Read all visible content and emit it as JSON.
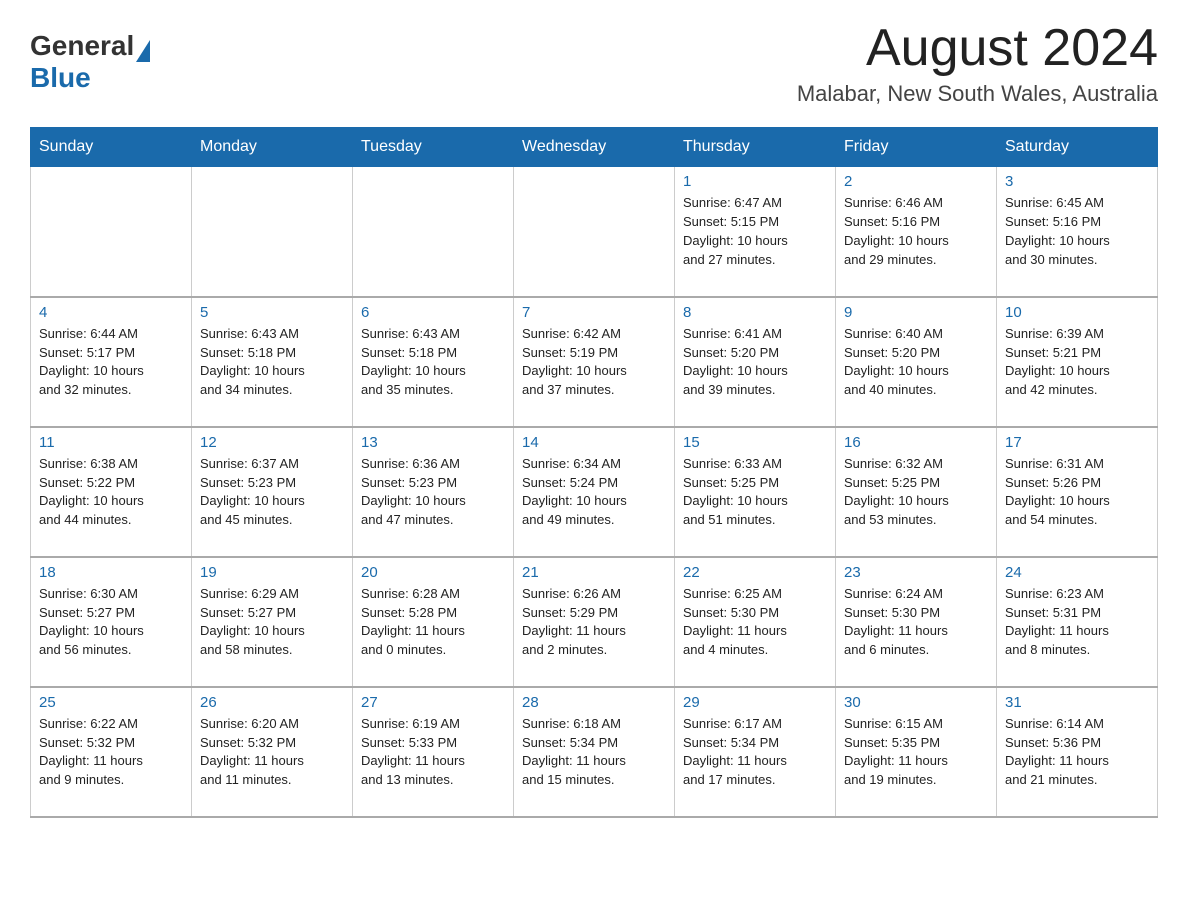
{
  "header": {
    "logo": {
      "general": "General",
      "blue": "Blue"
    },
    "title": "August 2024",
    "location": "Malabar, New South Wales, Australia"
  },
  "days_of_week": [
    "Sunday",
    "Monday",
    "Tuesday",
    "Wednesday",
    "Thursday",
    "Friday",
    "Saturday"
  ],
  "weeks": [
    [
      {
        "day": "",
        "info": ""
      },
      {
        "day": "",
        "info": ""
      },
      {
        "day": "",
        "info": ""
      },
      {
        "day": "",
        "info": ""
      },
      {
        "day": "1",
        "info": "Sunrise: 6:47 AM\nSunset: 5:15 PM\nDaylight: 10 hours\nand 27 minutes."
      },
      {
        "day": "2",
        "info": "Sunrise: 6:46 AM\nSunset: 5:16 PM\nDaylight: 10 hours\nand 29 minutes."
      },
      {
        "day": "3",
        "info": "Sunrise: 6:45 AM\nSunset: 5:16 PM\nDaylight: 10 hours\nand 30 minutes."
      }
    ],
    [
      {
        "day": "4",
        "info": "Sunrise: 6:44 AM\nSunset: 5:17 PM\nDaylight: 10 hours\nand 32 minutes."
      },
      {
        "day": "5",
        "info": "Sunrise: 6:43 AM\nSunset: 5:18 PM\nDaylight: 10 hours\nand 34 minutes."
      },
      {
        "day": "6",
        "info": "Sunrise: 6:43 AM\nSunset: 5:18 PM\nDaylight: 10 hours\nand 35 minutes."
      },
      {
        "day": "7",
        "info": "Sunrise: 6:42 AM\nSunset: 5:19 PM\nDaylight: 10 hours\nand 37 minutes."
      },
      {
        "day": "8",
        "info": "Sunrise: 6:41 AM\nSunset: 5:20 PM\nDaylight: 10 hours\nand 39 minutes."
      },
      {
        "day": "9",
        "info": "Sunrise: 6:40 AM\nSunset: 5:20 PM\nDaylight: 10 hours\nand 40 minutes."
      },
      {
        "day": "10",
        "info": "Sunrise: 6:39 AM\nSunset: 5:21 PM\nDaylight: 10 hours\nand 42 minutes."
      }
    ],
    [
      {
        "day": "11",
        "info": "Sunrise: 6:38 AM\nSunset: 5:22 PM\nDaylight: 10 hours\nand 44 minutes."
      },
      {
        "day": "12",
        "info": "Sunrise: 6:37 AM\nSunset: 5:23 PM\nDaylight: 10 hours\nand 45 minutes."
      },
      {
        "day": "13",
        "info": "Sunrise: 6:36 AM\nSunset: 5:23 PM\nDaylight: 10 hours\nand 47 minutes."
      },
      {
        "day": "14",
        "info": "Sunrise: 6:34 AM\nSunset: 5:24 PM\nDaylight: 10 hours\nand 49 minutes."
      },
      {
        "day": "15",
        "info": "Sunrise: 6:33 AM\nSunset: 5:25 PM\nDaylight: 10 hours\nand 51 minutes."
      },
      {
        "day": "16",
        "info": "Sunrise: 6:32 AM\nSunset: 5:25 PM\nDaylight: 10 hours\nand 53 minutes."
      },
      {
        "day": "17",
        "info": "Sunrise: 6:31 AM\nSunset: 5:26 PM\nDaylight: 10 hours\nand 54 minutes."
      }
    ],
    [
      {
        "day": "18",
        "info": "Sunrise: 6:30 AM\nSunset: 5:27 PM\nDaylight: 10 hours\nand 56 minutes."
      },
      {
        "day": "19",
        "info": "Sunrise: 6:29 AM\nSunset: 5:27 PM\nDaylight: 10 hours\nand 58 minutes."
      },
      {
        "day": "20",
        "info": "Sunrise: 6:28 AM\nSunset: 5:28 PM\nDaylight: 11 hours\nand 0 minutes."
      },
      {
        "day": "21",
        "info": "Sunrise: 6:26 AM\nSunset: 5:29 PM\nDaylight: 11 hours\nand 2 minutes."
      },
      {
        "day": "22",
        "info": "Sunrise: 6:25 AM\nSunset: 5:30 PM\nDaylight: 11 hours\nand 4 minutes."
      },
      {
        "day": "23",
        "info": "Sunrise: 6:24 AM\nSunset: 5:30 PM\nDaylight: 11 hours\nand 6 minutes."
      },
      {
        "day": "24",
        "info": "Sunrise: 6:23 AM\nSunset: 5:31 PM\nDaylight: 11 hours\nand 8 minutes."
      }
    ],
    [
      {
        "day": "25",
        "info": "Sunrise: 6:22 AM\nSunset: 5:32 PM\nDaylight: 11 hours\nand 9 minutes."
      },
      {
        "day": "26",
        "info": "Sunrise: 6:20 AM\nSunset: 5:32 PM\nDaylight: 11 hours\nand 11 minutes."
      },
      {
        "day": "27",
        "info": "Sunrise: 6:19 AM\nSunset: 5:33 PM\nDaylight: 11 hours\nand 13 minutes."
      },
      {
        "day": "28",
        "info": "Sunrise: 6:18 AM\nSunset: 5:34 PM\nDaylight: 11 hours\nand 15 minutes."
      },
      {
        "day": "29",
        "info": "Sunrise: 6:17 AM\nSunset: 5:34 PM\nDaylight: 11 hours\nand 17 minutes."
      },
      {
        "day": "30",
        "info": "Sunrise: 6:15 AM\nSunset: 5:35 PM\nDaylight: 11 hours\nand 19 minutes."
      },
      {
        "day": "31",
        "info": "Sunrise: 6:14 AM\nSunset: 5:36 PM\nDaylight: 11 hours\nand 21 minutes."
      }
    ]
  ]
}
